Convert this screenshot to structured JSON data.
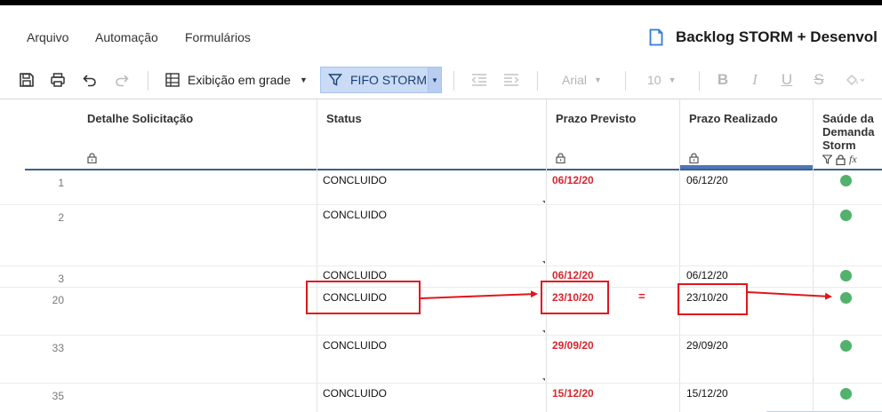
{
  "menu": {
    "items": [
      "Arquivo",
      "Automação",
      "Formulários"
    ]
  },
  "document": {
    "title": "Backlog STORM + Desenvol"
  },
  "toolbar": {
    "view_label": "Exibição em grade",
    "filter_label": "FIFO STORM",
    "font_name": "Arial",
    "font_size": "10",
    "bold": "B",
    "italic": "I",
    "underline": "U",
    "strike": "S"
  },
  "columns": {
    "detalhe": "Detalhe Solicitação",
    "status": "Status",
    "prazo_previsto": "Prazo Previsto",
    "prazo_realizado": "Prazo Realizado",
    "saude": "Saúde da Demanda Storm"
  },
  "rows": [
    {
      "num": "1",
      "status": "CONCLUIDO",
      "previsto": "06/12/20",
      "realizado": "06/12/20",
      "saude": "green"
    },
    {
      "num": "2",
      "status": "CONCLUIDO",
      "previsto": "",
      "realizado": "",
      "saude": "green"
    },
    {
      "num": "3",
      "status": "CONCLUIDO",
      "previsto": "06/12/20",
      "realizado": "06/12/20",
      "saude": "green"
    },
    {
      "num": "20",
      "status": "CONCLUIDO",
      "previsto": "23/10/20",
      "realizado": "23/10/20",
      "saude": "green"
    },
    {
      "num": "33",
      "status": "CONCLUIDO",
      "previsto": "29/09/20",
      "realizado": "29/09/20",
      "saude": "green"
    },
    {
      "num": "35",
      "status": "CONCLUIDO",
      "previsto": "15/12/20",
      "realizado": "15/12/20",
      "saude": "green"
    }
  ],
  "annotation": {
    "equals_sign": "="
  },
  "colors": {
    "late_date": "#d8262c",
    "health_green": "#52b16b",
    "annotation_red": "#e0161c",
    "filter_active": "#c9dbf5"
  }
}
